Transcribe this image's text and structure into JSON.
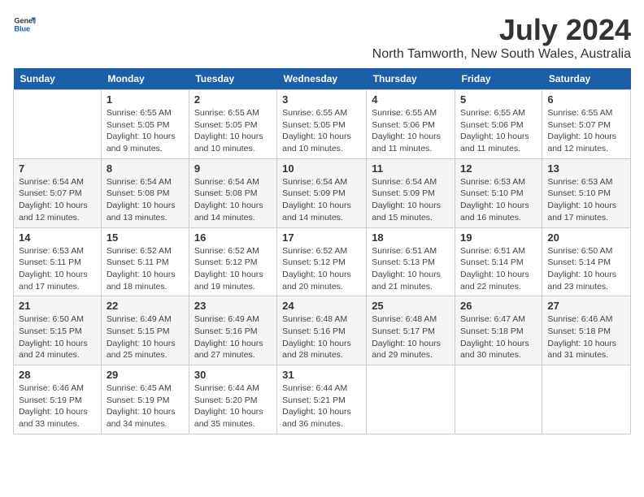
{
  "header": {
    "logo_line1": "General",
    "logo_line2": "Blue",
    "main_title": "July 2024",
    "subtitle": "North Tamworth, New South Wales, Australia"
  },
  "calendar": {
    "days_of_week": [
      "Sunday",
      "Monday",
      "Tuesday",
      "Wednesday",
      "Thursday",
      "Friday",
      "Saturday"
    ],
    "weeks": [
      [
        {
          "day": "",
          "info": ""
        },
        {
          "day": "1",
          "info": "Sunrise: 6:55 AM\nSunset: 5:05 PM\nDaylight: 10 hours\nand 9 minutes."
        },
        {
          "day": "2",
          "info": "Sunrise: 6:55 AM\nSunset: 5:05 PM\nDaylight: 10 hours\nand 10 minutes."
        },
        {
          "day": "3",
          "info": "Sunrise: 6:55 AM\nSunset: 5:05 PM\nDaylight: 10 hours\nand 10 minutes."
        },
        {
          "day": "4",
          "info": "Sunrise: 6:55 AM\nSunset: 5:06 PM\nDaylight: 10 hours\nand 11 minutes."
        },
        {
          "day": "5",
          "info": "Sunrise: 6:55 AM\nSunset: 5:06 PM\nDaylight: 10 hours\nand 11 minutes."
        },
        {
          "day": "6",
          "info": "Sunrise: 6:55 AM\nSunset: 5:07 PM\nDaylight: 10 hours\nand 12 minutes."
        }
      ],
      [
        {
          "day": "7",
          "info": "Sunrise: 6:54 AM\nSunset: 5:07 PM\nDaylight: 10 hours\nand 12 minutes."
        },
        {
          "day": "8",
          "info": "Sunrise: 6:54 AM\nSunset: 5:08 PM\nDaylight: 10 hours\nand 13 minutes."
        },
        {
          "day": "9",
          "info": "Sunrise: 6:54 AM\nSunset: 5:08 PM\nDaylight: 10 hours\nand 14 minutes."
        },
        {
          "day": "10",
          "info": "Sunrise: 6:54 AM\nSunset: 5:09 PM\nDaylight: 10 hours\nand 14 minutes."
        },
        {
          "day": "11",
          "info": "Sunrise: 6:54 AM\nSunset: 5:09 PM\nDaylight: 10 hours\nand 15 minutes."
        },
        {
          "day": "12",
          "info": "Sunrise: 6:53 AM\nSunset: 5:10 PM\nDaylight: 10 hours\nand 16 minutes."
        },
        {
          "day": "13",
          "info": "Sunrise: 6:53 AM\nSunset: 5:10 PM\nDaylight: 10 hours\nand 17 minutes."
        }
      ],
      [
        {
          "day": "14",
          "info": "Sunrise: 6:53 AM\nSunset: 5:11 PM\nDaylight: 10 hours\nand 17 minutes."
        },
        {
          "day": "15",
          "info": "Sunrise: 6:52 AM\nSunset: 5:11 PM\nDaylight: 10 hours\nand 18 minutes."
        },
        {
          "day": "16",
          "info": "Sunrise: 6:52 AM\nSunset: 5:12 PM\nDaylight: 10 hours\nand 19 minutes."
        },
        {
          "day": "17",
          "info": "Sunrise: 6:52 AM\nSunset: 5:12 PM\nDaylight: 10 hours\nand 20 minutes."
        },
        {
          "day": "18",
          "info": "Sunrise: 6:51 AM\nSunset: 5:13 PM\nDaylight: 10 hours\nand 21 minutes."
        },
        {
          "day": "19",
          "info": "Sunrise: 6:51 AM\nSunset: 5:14 PM\nDaylight: 10 hours\nand 22 minutes."
        },
        {
          "day": "20",
          "info": "Sunrise: 6:50 AM\nSunset: 5:14 PM\nDaylight: 10 hours\nand 23 minutes."
        }
      ],
      [
        {
          "day": "21",
          "info": "Sunrise: 6:50 AM\nSunset: 5:15 PM\nDaylight: 10 hours\nand 24 minutes."
        },
        {
          "day": "22",
          "info": "Sunrise: 6:49 AM\nSunset: 5:15 PM\nDaylight: 10 hours\nand 25 minutes."
        },
        {
          "day": "23",
          "info": "Sunrise: 6:49 AM\nSunset: 5:16 PM\nDaylight: 10 hours\nand 27 minutes."
        },
        {
          "day": "24",
          "info": "Sunrise: 6:48 AM\nSunset: 5:16 PM\nDaylight: 10 hours\nand 28 minutes."
        },
        {
          "day": "25",
          "info": "Sunrise: 6:48 AM\nSunset: 5:17 PM\nDaylight: 10 hours\nand 29 minutes."
        },
        {
          "day": "26",
          "info": "Sunrise: 6:47 AM\nSunset: 5:18 PM\nDaylight: 10 hours\nand 30 minutes."
        },
        {
          "day": "27",
          "info": "Sunrise: 6:46 AM\nSunset: 5:18 PM\nDaylight: 10 hours\nand 31 minutes."
        }
      ],
      [
        {
          "day": "28",
          "info": "Sunrise: 6:46 AM\nSunset: 5:19 PM\nDaylight: 10 hours\nand 33 minutes."
        },
        {
          "day": "29",
          "info": "Sunrise: 6:45 AM\nSunset: 5:19 PM\nDaylight: 10 hours\nand 34 minutes."
        },
        {
          "day": "30",
          "info": "Sunrise: 6:44 AM\nSunset: 5:20 PM\nDaylight: 10 hours\nand 35 minutes."
        },
        {
          "day": "31",
          "info": "Sunrise: 6:44 AM\nSunset: 5:21 PM\nDaylight: 10 hours\nand 36 minutes."
        },
        {
          "day": "",
          "info": ""
        },
        {
          "day": "",
          "info": ""
        },
        {
          "day": "",
          "info": ""
        }
      ]
    ]
  }
}
